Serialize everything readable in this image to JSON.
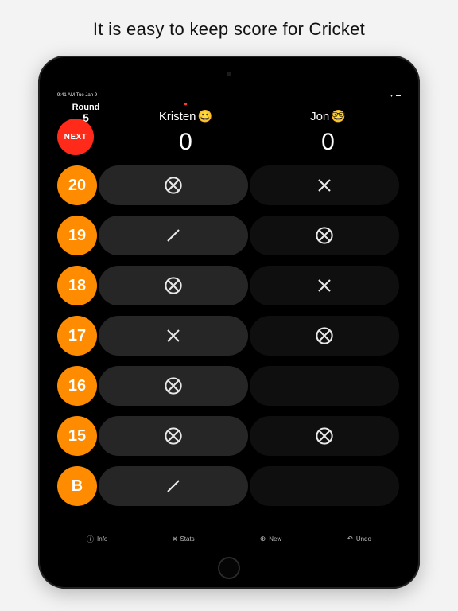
{
  "headline": "It is easy to keep score for Cricket",
  "status": {
    "left": "9:41 AM   Tue Jan 9",
    "wifi": "wifi",
    "battery": "battery"
  },
  "round": {
    "label": "Round",
    "number": "5"
  },
  "next_label": "NEXT",
  "players": [
    {
      "name": "Kristen",
      "emoji": "😀",
      "score": "0",
      "is_turn": true
    },
    {
      "name": "Jon",
      "emoji": "🤓",
      "score": "0",
      "is_turn": false
    }
  ],
  "targets": [
    {
      "label": "20",
      "p1": "closed",
      "p2": "x"
    },
    {
      "label": "19",
      "p1": "slash",
      "p2": "closed"
    },
    {
      "label": "18",
      "p1": "closed",
      "p2": "x"
    },
    {
      "label": "17",
      "p1": "x",
      "p2": "closed"
    },
    {
      "label": "16",
      "p1": "closed",
      "p2": ""
    },
    {
      "label": "15",
      "p1": "closed",
      "p2": "closed"
    },
    {
      "label": "B",
      "p1": "slash",
      "p2": ""
    }
  ],
  "toolbar": {
    "info": {
      "icon": "ⓘ",
      "label": "Info"
    },
    "stats": {
      "icon": "⩙",
      "label": "Stats"
    },
    "new": {
      "icon": "⊕",
      "label": "New"
    },
    "undo": {
      "icon": "↶",
      "label": "Undo"
    }
  },
  "colors": {
    "accent": "#ff8c00",
    "next": "#ff2a1a"
  }
}
